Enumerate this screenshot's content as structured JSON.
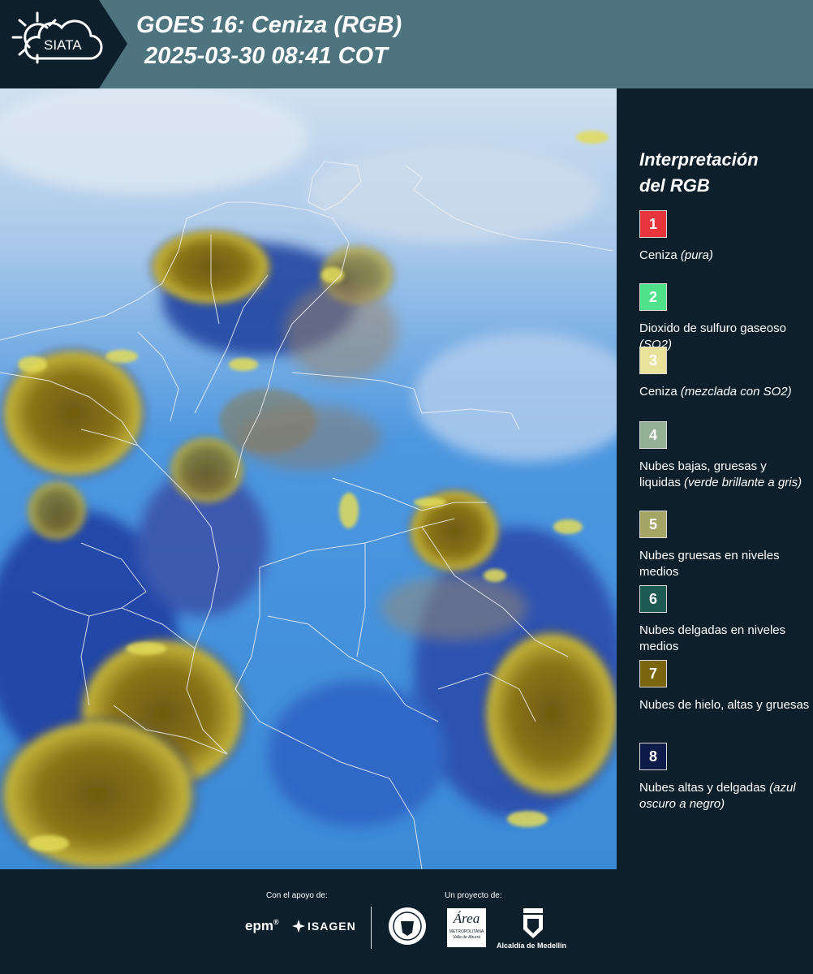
{
  "header": {
    "logo_text": "SIATA",
    "title_line1": "GOES 16: Ceniza (RGB)",
    "title_line2": "2025-03-30 08:41 COT",
    "background": "#4e7480"
  },
  "legend": {
    "title_line1": "Interpretación",
    "title_line2": "del RGB",
    "items": [
      {
        "number": "1",
        "color": "#e8343b",
        "text": "Ceniza",
        "note": "(pura)"
      },
      {
        "number": "2",
        "color": "#4fe28a",
        "text": "Dioxido de sulfuro gaseoso",
        "note": "(SO2)"
      },
      {
        "number": "3",
        "color": "#e8e29a",
        "text": "Ceniza",
        "note": "(mezclada con SO2)"
      },
      {
        "number": "4",
        "color": "#94b095",
        "text": "Nubes bajas, gruesas y liquidas",
        "note": "(verde brillante a gris)"
      },
      {
        "number": "5",
        "color": "#a5a565",
        "text": "Nubes gruesas en niveles medios",
        "note": ""
      },
      {
        "number": "6",
        "color": "#1e5a54",
        "text": "Nubes delgadas en niveles medios",
        "note": ""
      },
      {
        "number": "7",
        "color": "#7a650c",
        "text": "Nubes de hielo, altas y gruesas",
        "note": ""
      },
      {
        "number": "8",
        "color": "#0b1a48",
        "text": "Nubes altas y delgadas",
        "note": "(azul oscuro a negro)"
      }
    ]
  },
  "footer": {
    "support_label": "Con el apoyo de:",
    "project_label": "Un proyecto de:",
    "epm": "epm",
    "isagen": "ISAGEN",
    "area_title": "Área",
    "area_sub1": "METROPOLITANA",
    "area_sub2": "Valle de Aburrá",
    "alcaldia": "Alcaldía de Medellín"
  }
}
